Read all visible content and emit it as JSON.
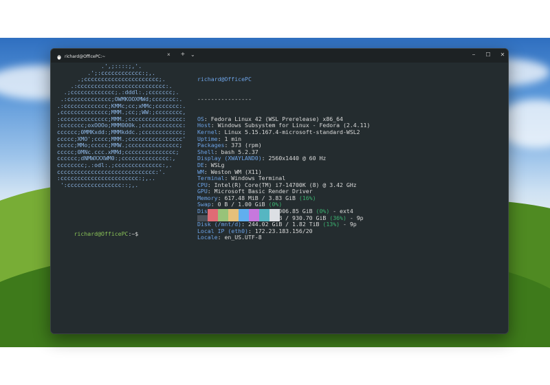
{
  "window": {
    "tab_title": "richard@OfficePC:~",
    "tab_close": "×",
    "new_tab": "+",
    "tab_menu": "⌄",
    "minimize": "−",
    "maximize": "☐",
    "close": "✕"
  },
  "logo_lines": [
    "              .',;::::;,'.",
    "          .';:cccccccccccc:;,.",
    "       .;cccccccccccccccccccccc;.",
    "     .:cccccccccccccccccccccccccc:.",
    "   .;ccccccccccccc;.:dddl:.;ccccccc;.",
    "  .:ccccccccccccc;OWMKOOXMWd;ccccccc:.",
    " .:ccccccccccccc;KMMc;cc;xMMc;ccccccc:.",
    " ,cccccccccccccc;MMM.;cc;;WW:;cccccccc,",
    " :cccccccccccccc;MMM.;cccccccccccccccc:",
    " :ccccccc;oxOOOo;MMM000k.;cccccccccccc:",
    " cccccc;0MMKxdd:;MMMkddc.;cccccccccccc;",
    " ccccc;XMO';cccc;MMM.;cccccccccccccccc'",
    " ccccc;MMo;ccccc;MMW.;ccccccccccccccc;",
    " ccccc;0MNc.ccc.xMMd;ccccccccccccccc;",
    " cccccc;dNMWXXXWM0:;cccccccccccccc:,",
    " cccccccc;.:odl:.;cccccccccccccc:,.",
    " ccccccccccccccccccccccccccccc:'.",
    " :ccccccccccccccccccccccc:;,..",
    "  ':cccccccccccccccc::;,."
  ],
  "info": {
    "user_host": "richard@OfficePC",
    "separator": "----------------",
    "rows": [
      {
        "key": "OS",
        "value": "Fedora Linux 42 (WSL Prerelease) x86_64"
      },
      {
        "key": "Host",
        "value": "Windows Subsystem for Linux - Fedora (2.4.11)"
      },
      {
        "key": "Kernel",
        "value": "Linux 5.15.167.4-microsoft-standard-WSL2"
      },
      {
        "key": "Uptime",
        "value": "1 min"
      },
      {
        "key": "Packages",
        "value": "373 (rpm)"
      },
      {
        "key": "Shell",
        "value": "bash 5.2.37"
      },
      {
        "key": "Display (XWAYLAND0)",
        "value": "2560x1440 @ 60 Hz"
      },
      {
        "key": "DE",
        "value": "WSLg"
      },
      {
        "key": "WM",
        "value": "Weston WM (X11)"
      },
      {
        "key": "Terminal",
        "value": "Windows Terminal"
      },
      {
        "key": "CPU",
        "value": "Intel(R) Core(TM) i7-14700K (8) @ 3.42 GHz"
      },
      {
        "key": "GPU",
        "value": "Microsoft Basic Render Driver"
      },
      {
        "key": "Memory",
        "value": "617.48 MiB / 3.83 GiB ",
        "pct": "(16%)"
      },
      {
        "key": "Swap",
        "value": "0 B / 1.00 GiB ",
        "pct": "(0%)"
      },
      {
        "key": "Disk (/)",
        "value": "994.07 MiB / 1006.85 GiB ",
        "pct": "(0%)",
        "tail": " - ext4"
      },
      {
        "key": "Disk (/mnt/c)",
        "value": "334.00 GiB / 930.70 GiB ",
        "pct": "(36%)",
        "tail": " - 9p"
      },
      {
        "key": "Disk (/mnt/d)",
        "value": "244.02 GiB / 1.82 TiB ",
        "pct": "(13%)",
        "tail": " - 9p"
      },
      {
        "key": "Local IP (eth0)",
        "value": "172.23.183.156/20"
      },
      {
        "key": "Locale",
        "value": "en_US.UTF-8"
      }
    ]
  },
  "palette": [
    "#4a5058",
    "#e06c75",
    "#98c379",
    "#e5c07b",
    "#61afef",
    "#c678dd",
    "#56b6c2",
    "#dcdfe4"
  ],
  "prompt": {
    "host": "richard@OfficePC",
    "path": ":~$"
  }
}
